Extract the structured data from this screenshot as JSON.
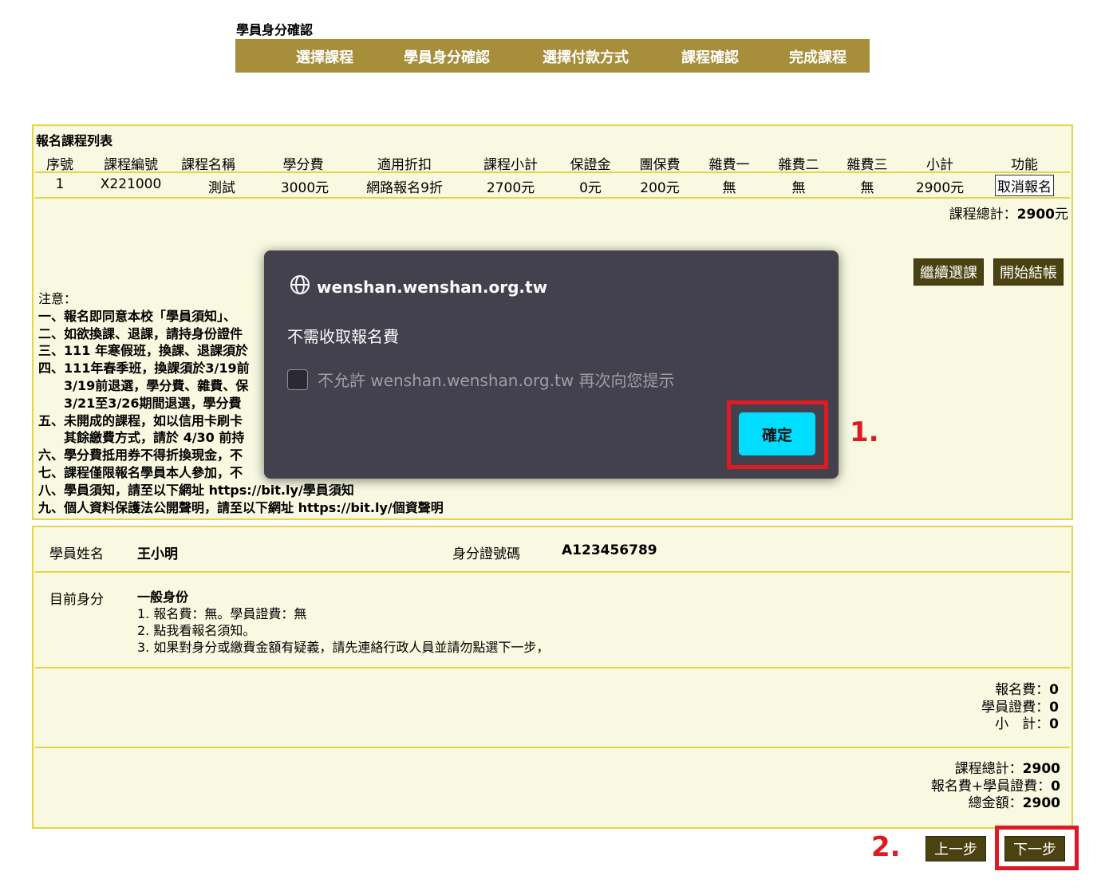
{
  "page": {
    "heading": "學員身分確認"
  },
  "steps": [
    "選擇課程",
    "學員身分確認",
    "選擇付款方式",
    "課程確認",
    "完成課程"
  ],
  "course_list": {
    "title": "報名課程列表",
    "headers": [
      "序號",
      "課程編號",
      "課程名稱",
      "學分費",
      "適用折扣",
      "課程小計",
      "保證金",
      "團保費",
      "雜費一",
      "雜費二",
      "雜費三",
      "小計",
      "功能"
    ],
    "rows": [
      {
        "no": "1",
        "code": "X221000",
        "name": "測試",
        "credit_fee": "3000元",
        "discount": "網路報名9折",
        "course_subtotal": "2700元",
        "deposit": "0元",
        "insurance": "200元",
        "misc1": "無",
        "misc2": "無",
        "misc3": "無",
        "subtotal": "2900元",
        "action": "取消報名"
      }
    ],
    "total_label": "課程總計：",
    "total_value": "2900",
    "total_unit": "元",
    "continue_label": "繼續選課",
    "checkout_label": "開始結帳"
  },
  "notes": {
    "heading": "注意：",
    "items": [
      "一、報名即同意本校「學員須知」、",
      "二、如欲換課、退課，請持身份證件",
      "三、111 年寒假班，換課、退課須於",
      "四、111年春季班，換課須於3/19前",
      "　　3/19前退選，學分費、雜費、保",
      "　　3/21至3/26期間退選，學分費",
      "五、未開成的課程，如以信用卡刷卡",
      "　　其餘繳費方式，請於 4/30 前持",
      "六、學分費抵用券不得折換現金，不",
      "七、課程僅限報名學員本人參加，不",
      "八、學員須知，請至以下網址 https://bit.ly/學員須知",
      "九、個人資料保護法公開聲明，請至以下網址 https://bit.ly/個資聲明"
    ]
  },
  "student": {
    "name_label": "學員姓名",
    "name_value": "王小明",
    "id_label": "身分證號碼",
    "id_value": "A123456789",
    "status_label": "目前身分",
    "status_value": "一般身份",
    "status_lines": [
      "1. 報名費：無。學員證費：無",
      "2. 點我看報名須知。",
      "3. 如果對身分或繳費金額有疑義，請先連絡行政人員並請勿點選下一步，"
    ],
    "fees": [
      {
        "label": "報名費：",
        "value": "0"
      },
      {
        "label": "學員證費：",
        "value": "0"
      },
      {
        "label": "小　計：",
        "value": "0"
      }
    ],
    "totals": [
      {
        "label": "課程總計：",
        "value": "2900"
      },
      {
        "label": "報名費+學員證費：",
        "value": "0"
      },
      {
        "label": "總金額：",
        "value": "2900"
      }
    ]
  },
  "nav": {
    "prev_label": "上一步",
    "next_label": "下一步"
  },
  "annotations": {
    "step1": "1.",
    "step2": "2."
  },
  "dialog": {
    "origin": "wenshan.wenshan.org.tw",
    "message": "不需收取報名費",
    "checkbox_label": "不允許 wenshan.wenshan.org.tw 再次向您提示",
    "ok_label": "確定"
  },
  "colors": {
    "header_gold": "#a68e3b",
    "panel_bg": "#f8f9e0",
    "border_yellow": "#e3d44a",
    "dark_button": "#4a4211",
    "dialog_bg": "#42414d",
    "ok_cyan": "#00ddff",
    "annotation_red": "#e01922"
  }
}
